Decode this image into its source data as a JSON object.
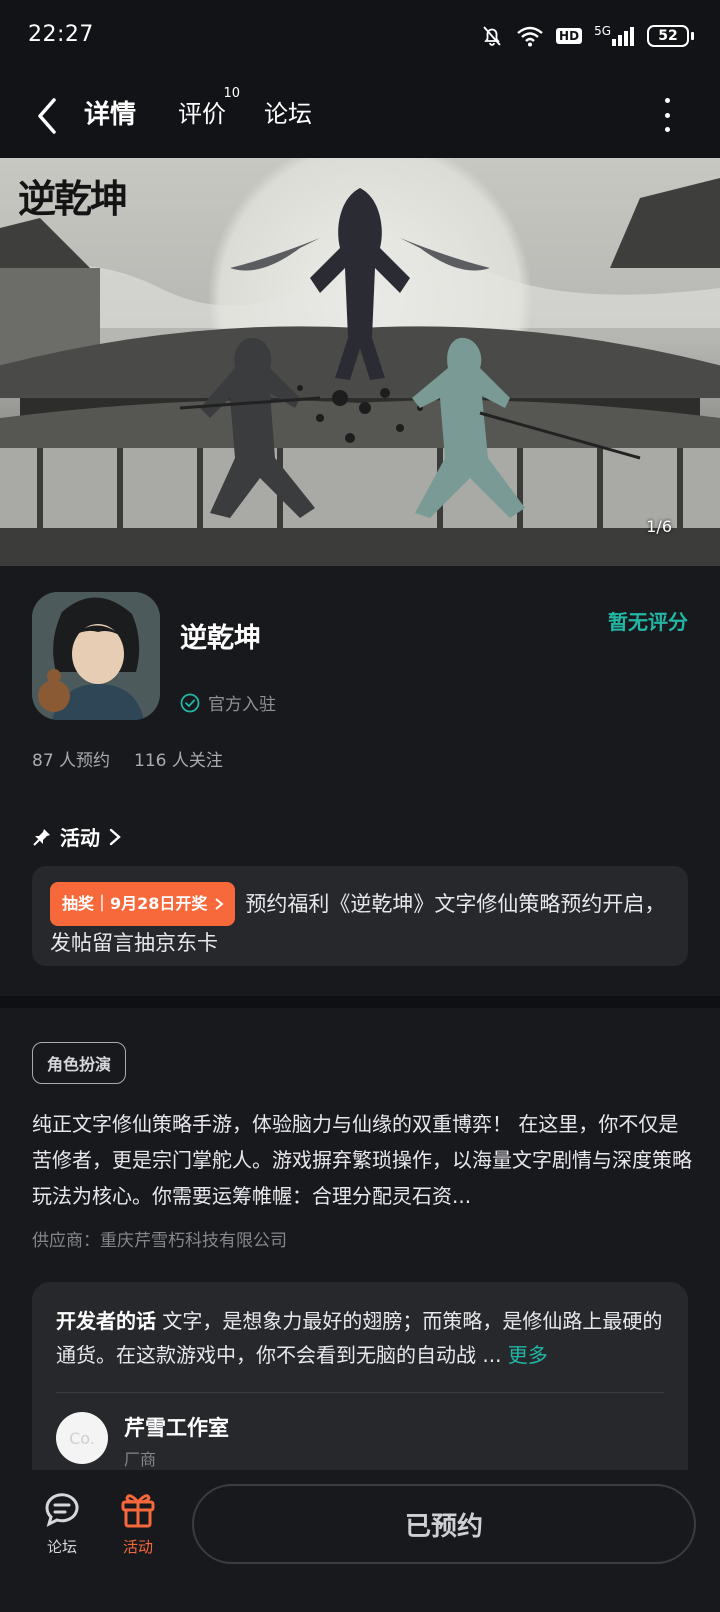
{
  "status_bar": {
    "time": "22:27",
    "network_label": "5G",
    "hd_label": "HD",
    "battery": "52"
  },
  "nav": {
    "tabs": [
      {
        "label": "详情",
        "active": true
      },
      {
        "label": "评价",
        "badge": "10"
      },
      {
        "label": "论坛"
      }
    ]
  },
  "banner": {
    "logo_text": "逆乾坤",
    "counter": "1/6"
  },
  "app": {
    "name": "逆乾坤",
    "official_label": "官方入驻",
    "rating_text": "暂无评分",
    "reservations": "87 人预约",
    "followers": "116 人关注"
  },
  "activity": {
    "heading": "活动",
    "badge": "抽奖｜9月28日开奖",
    "text": "预约福利《逆乾坤》文字修仙策略预约开启，发帖留言抽京东卡"
  },
  "description": {
    "tag": "角色扮演",
    "text": "纯正文字修仙策略手游，体验脑力与仙缘的双重博弈！ 在这里，你不仅是苦修者，更是宗门掌舵人。游戏摒弃繁琐操作，以海量文字剧情与深度策略玩法为核心。你需要运筹帷幄：合理分配灵石资...",
    "supplier": "供应商：重庆芹雪朽科技有限公司"
  },
  "developer": {
    "title": "开发者的话",
    "text": "文字，是想象力最好的翅膀；而策略，是修仙路上最硬的通货。在这款游戏中，你不会看到无脑的自动战 ...",
    "more_label": "更多",
    "avatar_text": "Co.",
    "name": "芹雪工作室",
    "role": "厂商"
  },
  "bottom_bar": {
    "forum_label": "论坛",
    "activity_label": "活动",
    "reserved_label": "已预约"
  },
  "colors": {
    "accent": "#22b7a4",
    "orange": "#f7683a",
    "background": "#18191d"
  }
}
